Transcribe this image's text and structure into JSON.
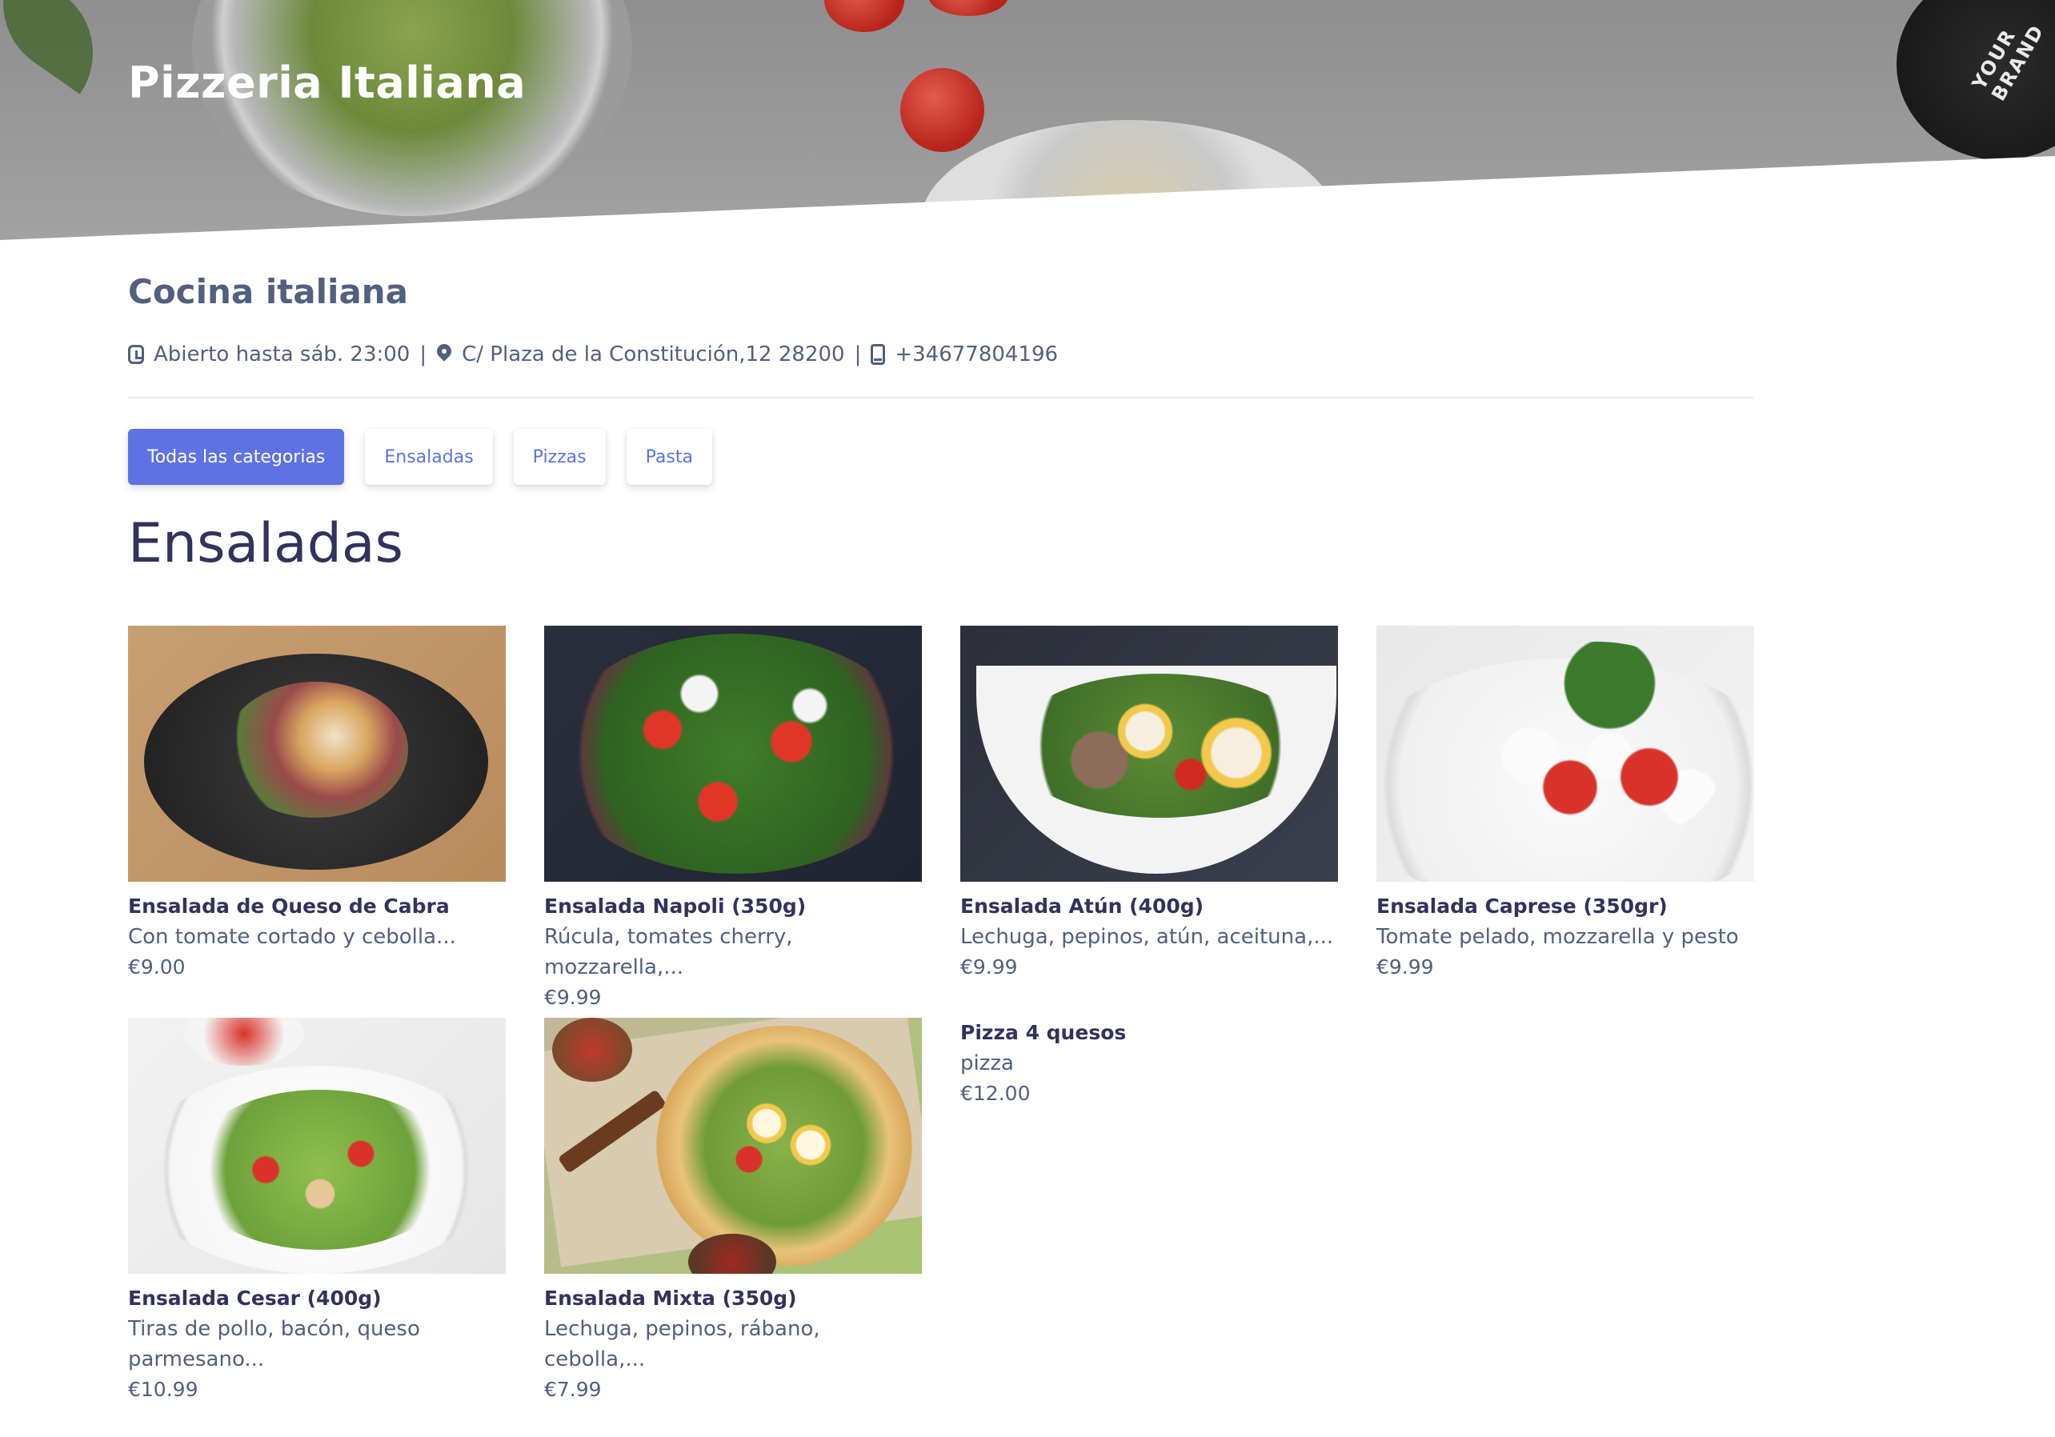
{
  "header": {
    "title": "Pizzeria Italiana",
    "brand_text": "YOUR BRAND"
  },
  "restaurant": {
    "cuisine": "Cocina italiana",
    "hours": "Abierto hasta sáb. 23:00",
    "address": "C/ Plaza de la Constitución,12 28200",
    "phone": "+34677804196",
    "separator": "|"
  },
  "tabs": [
    {
      "label": "Todas las categorias",
      "active": true
    },
    {
      "label": "Ensaladas",
      "active": false
    },
    {
      "label": "Pizzas",
      "active": false
    },
    {
      "label": "Pasta",
      "active": false
    }
  ],
  "section": {
    "title": "Ensaladas"
  },
  "items": [
    {
      "name": "Ensalada de Queso de Cabra",
      "description": "Con tomate cortado y cebolla...",
      "price": "€9.00"
    },
    {
      "name": "Ensalada Napoli (350g)",
      "description": "Rúcula, tomates cherry, mozzarella,...",
      "price": "€9.99"
    },
    {
      "name": "Ensalada Atún (400g)",
      "description": "Lechuga, pepinos, atún, aceituna,...",
      "price": "€9.99"
    },
    {
      "name": "Ensalada Caprese (350gr)",
      "description": "Tomate pelado, mozzarella y pesto",
      "price": "€9.99"
    },
    {
      "name": "Ensalada Cesar (400g)",
      "description": "Tiras de pollo, bacón, queso parmesano...",
      "price": "€10.99"
    },
    {
      "name": "Ensalada Mixta (350g)",
      "description": "Lechuga, pepinos, rábano, cebolla,...",
      "price": "€7.99"
    },
    {
      "name": "Pizza 4 quesos",
      "description": "pizza",
      "price": "€12.00"
    }
  ],
  "colors": {
    "accent": "#5e72e4",
    "heading": "#32325d",
    "text": "#525f7f"
  }
}
